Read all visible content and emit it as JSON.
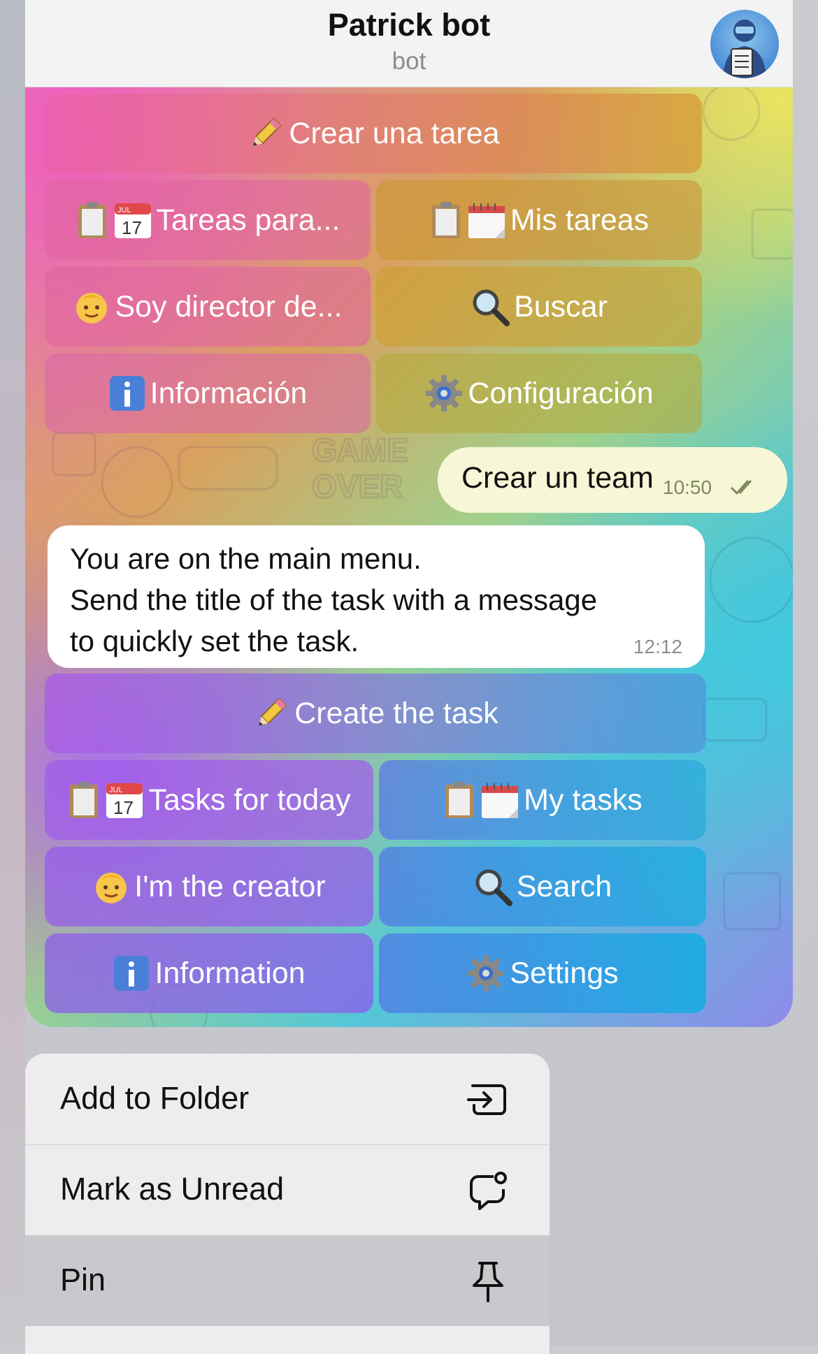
{
  "header": {
    "title": "Patrick bot",
    "subtitle": "bot"
  },
  "keyboard_es": {
    "create": "Crear una tarea",
    "tasks_for": "Tareas para...",
    "my_tasks": "Mis tareas",
    "director": "Soy director de...",
    "search": "Buscar",
    "info": "Información",
    "settings": "Configuración"
  },
  "outgoing": {
    "text": "Crear un team",
    "time": "10:50"
  },
  "incoming": {
    "lines": [
      "You are on the main menu.",
      "Send the title of the task with a message",
      "to quickly set the task."
    ],
    "time": "12:12"
  },
  "keyboard_en": {
    "create": "Create the task",
    "tasks_for": "Tasks for today",
    "my_tasks": "My tasks",
    "creator": "I'm the creator",
    "search": "Search",
    "info": "Information",
    "settings": "Settings"
  },
  "calendar": {
    "month": "JUL",
    "day": "17"
  },
  "background_text": [
    "GAME",
    "OVER"
  ],
  "context_menu": {
    "items": [
      {
        "label": "Add to Folder",
        "icon": "folder-move-icon"
      },
      {
        "label": "Mark as Unread",
        "icon": "unread-bubble-icon"
      },
      {
        "label": "Pin",
        "icon": "pin-icon"
      }
    ]
  }
}
